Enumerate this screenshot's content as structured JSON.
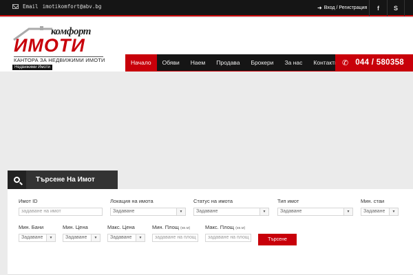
{
  "topbar": {
    "email_label": "Email",
    "email": "imotikomfort@abv.bg",
    "login": "Вход / Регистрация",
    "facebook": "f",
    "skype": "S"
  },
  "logo": {
    "word1": "комфорт",
    "word2": "ИМОТИ",
    "subtitle": "КАНТОРА ЗА НЕДВИЖИМИ ИМОТИ",
    "tag": "Недвижими Имоти"
  },
  "nav": {
    "items": [
      "Начало",
      "Обяви",
      "Наем",
      "Продава",
      "Брокери",
      "За нас",
      "Контакти"
    ],
    "active_index": 0
  },
  "phone": "044 / 580358",
  "search": {
    "title": "Търсене На Имот",
    "fields": {
      "id": {
        "label": "Имот ID",
        "placeholder": "задаване на имот"
      },
      "location": {
        "label": "Локация на имота",
        "value": "Задаване"
      },
      "status": {
        "label": "Статус на имота",
        "value": "Задаване"
      },
      "type": {
        "label": "Тип имот",
        "value": "Задаване"
      },
      "rooms": {
        "label": "Мин. стаи",
        "value": "Задаване"
      },
      "baths": {
        "label": "Мин. Бани",
        "value": "Задаване"
      },
      "min_price": {
        "label": "Мин. Цена",
        "value": "Задаване"
      },
      "max_price": {
        "label": "Макс. Цена",
        "value": "Задаване"
      },
      "min_area": {
        "label": "Мин. Площ",
        "unit": "(кв.м)",
        "placeholder": "задаване на площ"
      },
      "max_area": {
        "label": "Макс. Площ",
        "unit": "(кв.м)",
        "placeholder": "задаване на площ"
      }
    },
    "button": "Търсене"
  },
  "colors": {
    "accent": "#c8000a",
    "dark": "#151515",
    "background": "#ebebeb"
  }
}
